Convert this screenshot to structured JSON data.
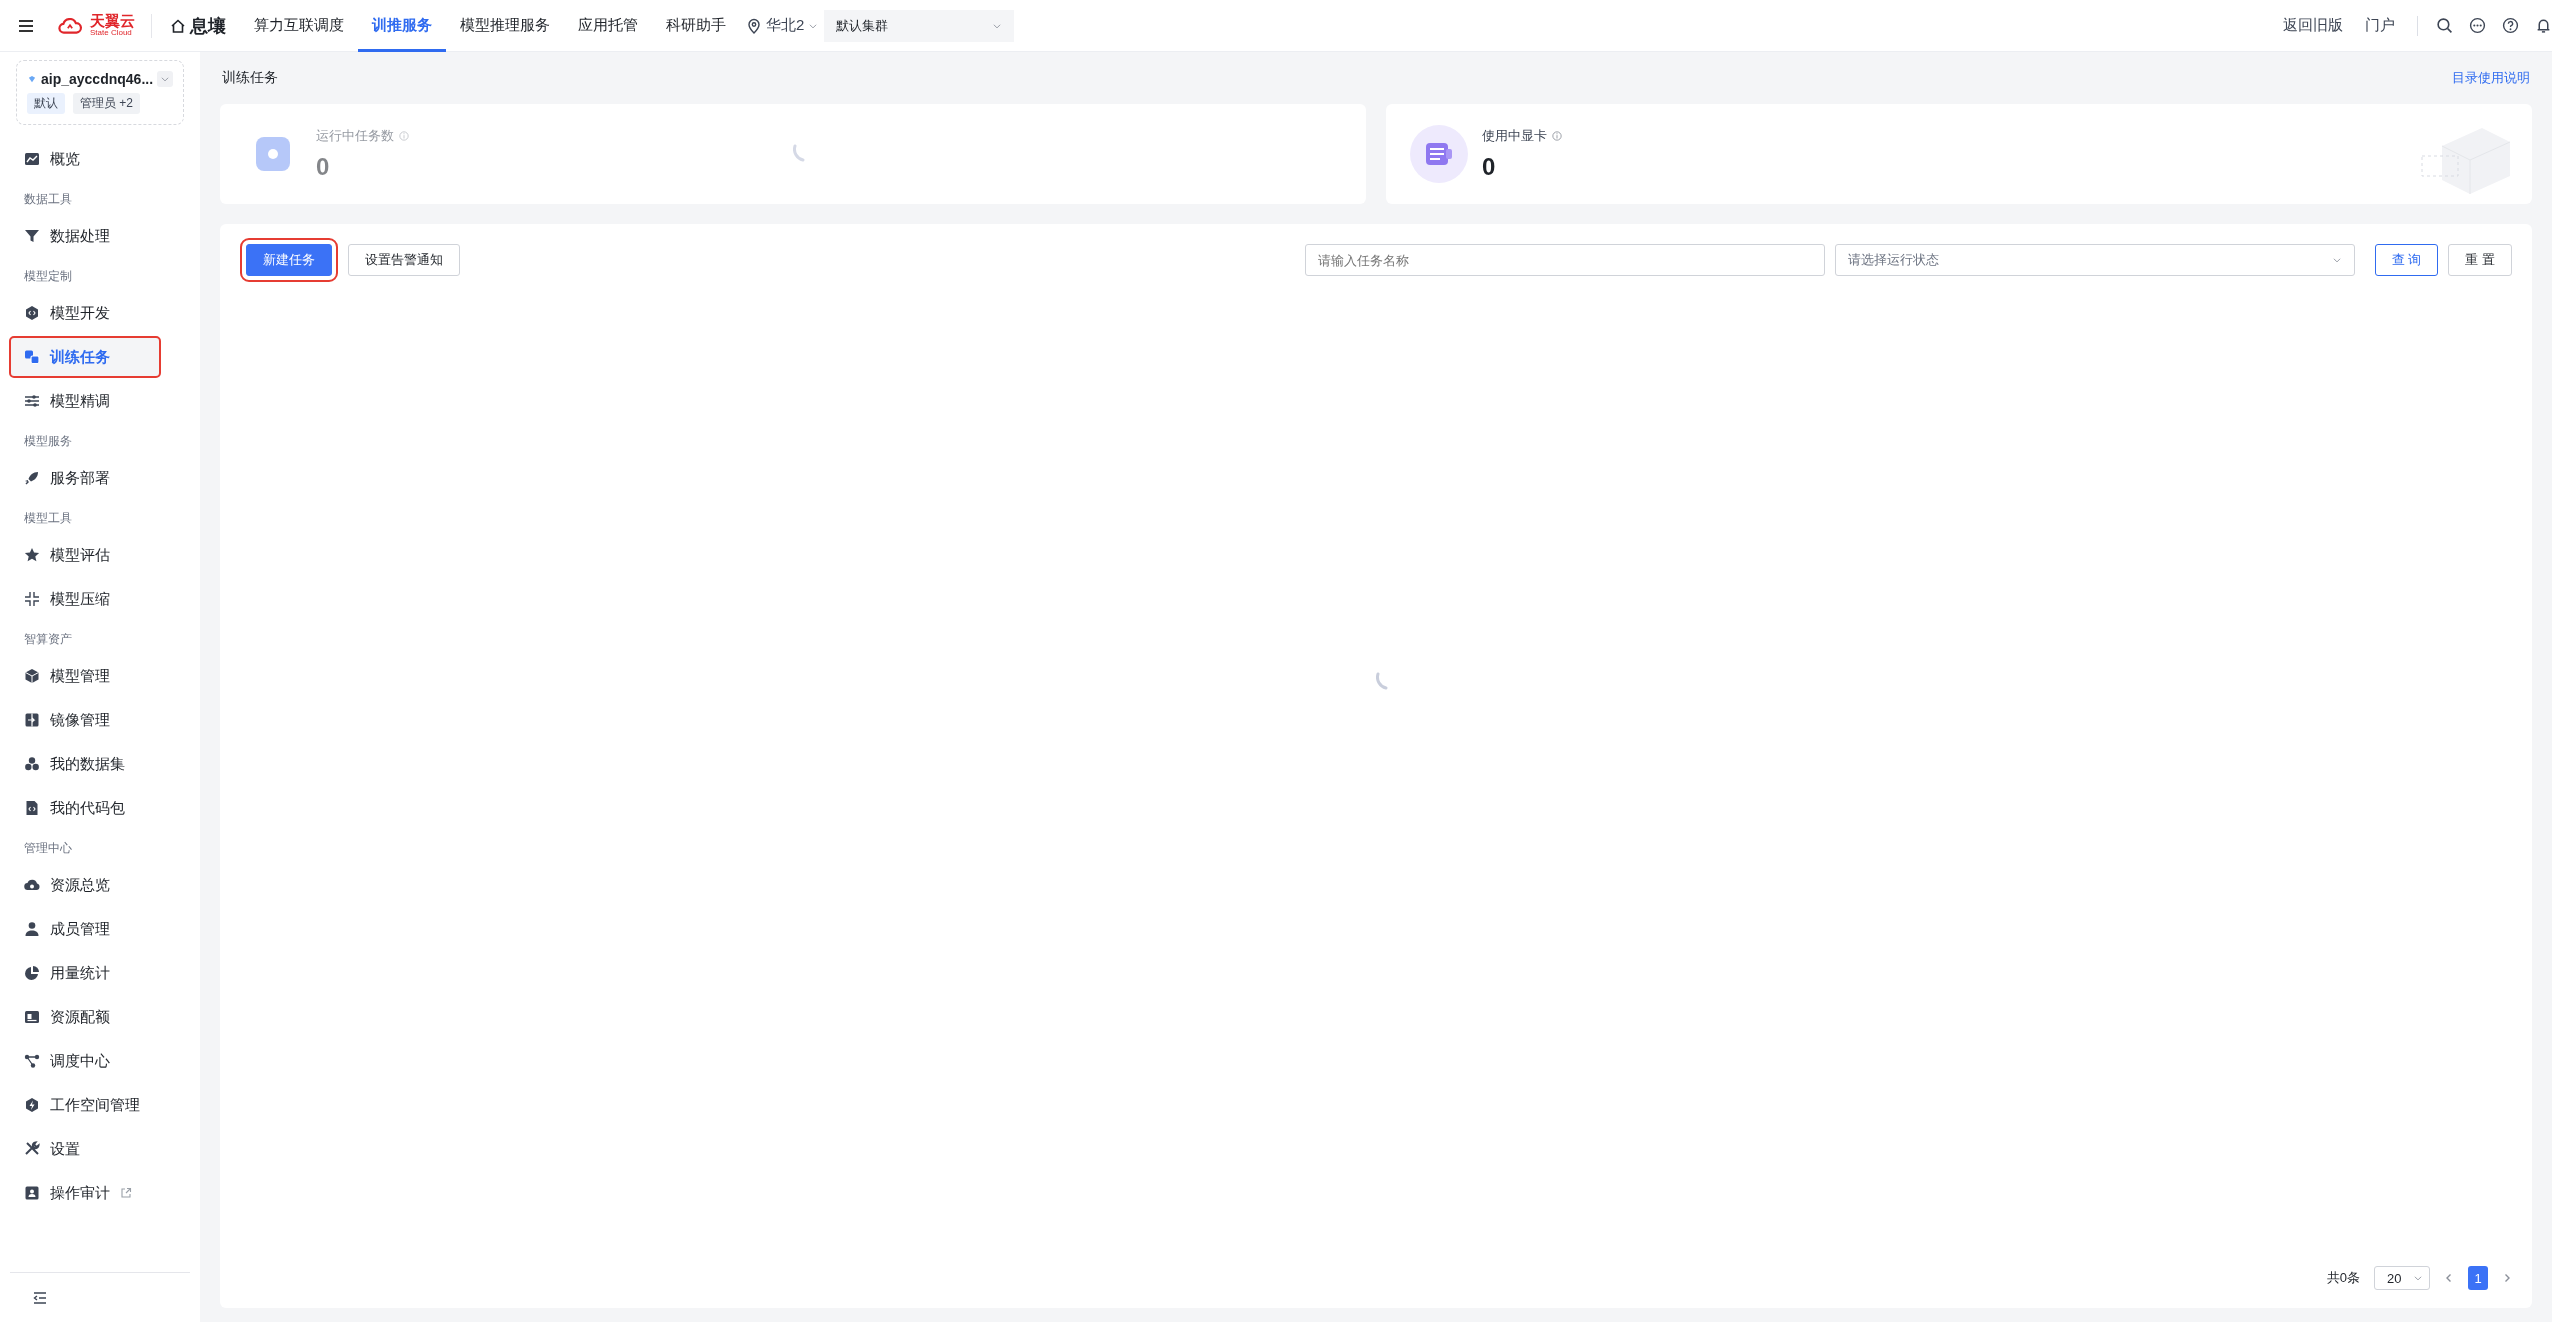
{
  "topbar": {
    "brand": {
      "name": "天翼云",
      "tagline": "State Cloud"
    },
    "product": "息壤",
    "nav": [
      {
        "label": "算力互联调度",
        "selected": false
      },
      {
        "label": "训推服务",
        "selected": true
      },
      {
        "label": "模型推理服务",
        "selected": false
      },
      {
        "label": "应用托管",
        "selected": false
      },
      {
        "label": "科研助手",
        "selected": false
      }
    ],
    "region": "华北2",
    "cluster": "默认集群",
    "links": [
      "返回旧版",
      "门户"
    ]
  },
  "sidebar": {
    "workspace": {
      "name": "aip_ayccdnq46...",
      "tags": [
        "默认",
        "管理员 +2"
      ]
    },
    "sections": [
      {
        "items": [
          {
            "label": "概览",
            "selected": false
          }
        ]
      },
      {
        "heading": "数据工具",
        "items": [
          {
            "label": "数据处理",
            "selected": false
          }
        ]
      },
      {
        "heading": "模型定制",
        "items": [
          {
            "label": "模型开发",
            "selected": false
          },
          {
            "label": "训练任务",
            "selected": true,
            "highlighted": true
          },
          {
            "label": "模型精调",
            "selected": false
          }
        ]
      },
      {
        "heading": "模型服务",
        "items": [
          {
            "label": "服务部署",
            "selected": false
          }
        ]
      },
      {
        "heading": "模型工具",
        "items": [
          {
            "label": "模型评估",
            "selected": false
          },
          {
            "label": "模型压缩",
            "selected": false
          }
        ]
      },
      {
        "heading": "智算资产",
        "items": [
          {
            "label": "模型管理",
            "selected": false
          },
          {
            "label": "镜像管理",
            "selected": false
          },
          {
            "label": "我的数据集",
            "selected": false
          },
          {
            "label": "我的代码包",
            "selected": false
          }
        ]
      },
      {
        "heading": "管理中心",
        "items": [
          {
            "label": "资源总览",
            "selected": false
          },
          {
            "label": "成员管理",
            "selected": false
          },
          {
            "label": "用量统计",
            "selected": false
          },
          {
            "label": "资源配额",
            "selected": false
          },
          {
            "label": "调度中心",
            "selected": false
          },
          {
            "label": "工作空间管理",
            "selected": false
          },
          {
            "label": "设置",
            "selected": false
          },
          {
            "label": "操作审计",
            "selected": false,
            "external": true
          }
        ]
      }
    ]
  },
  "page": {
    "title": "训练任务",
    "help_link": "目录使用说明",
    "cards": [
      {
        "label": "运行中任务数",
        "value": "0",
        "loading": true
      },
      {
        "label": "使用中显卡",
        "value": "0",
        "loading": false
      }
    ],
    "toolbar": {
      "buttons": [
        {
          "label": "新建任务",
          "kind": "primary",
          "highlighted": true
        },
        {
          "label": "设置告警通知",
          "kind": "outline",
          "highlighted": false
        }
      ],
      "search": {
        "placeholder": "请输入任务名称"
      },
      "status_select": {
        "placeholder": "请选择运行状态"
      },
      "query": "查 询",
      "reset": "重 置"
    },
    "table": {
      "loading": true
    },
    "pagination": {
      "total": "共0条",
      "page_size": "20",
      "pages": [
        {
          "label": "1",
          "selected": true
        }
      ]
    }
  }
}
